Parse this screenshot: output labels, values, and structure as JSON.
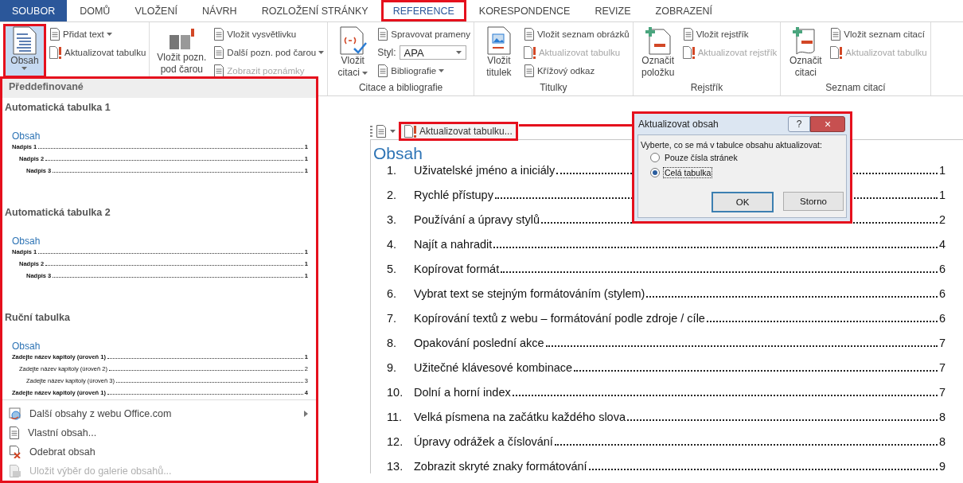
{
  "tabs": [
    {
      "label": "SOUBOR",
      "kind": "file",
      "selected": false
    },
    {
      "label": "DOMŮ",
      "kind": "tab",
      "selected": false
    },
    {
      "label": "VLOŽENÍ",
      "kind": "tab",
      "selected": false
    },
    {
      "label": "NÁVRH",
      "kind": "tab",
      "selected": false
    },
    {
      "label": "ROZLOŽENÍ STRÁNKY",
      "kind": "tab",
      "selected": false
    },
    {
      "label": "REFERENCE",
      "kind": "tab",
      "selected": true
    },
    {
      "label": "KORESPONDENCE",
      "kind": "tab",
      "selected": false
    },
    {
      "label": "REVIZE",
      "kind": "tab",
      "selected": false
    },
    {
      "label": "ZOBRAZENÍ",
      "kind": "tab",
      "selected": false
    }
  ],
  "ribbon": {
    "groups": [
      {
        "large": [
          {
            "lines": [
              "Obsah"
            ],
            "caret": true,
            "pressed": true
          }
        ],
        "small": [
          {
            "kind": "button",
            "label": "Přidat text",
            "caret": true,
            "disabled": false
          },
          {
            "kind": "button",
            "label": "Aktualizovat tabulku",
            "caret": false,
            "disabled": false
          }
        ]
      },
      {
        "large": [
          {
            "lines": [
              "Vložit pozn.",
              "pod čarou"
            ],
            "caret": false,
            "pressed": false
          }
        ],
        "small": [
          {
            "kind": "button",
            "label": "Vložit vysvětlivku",
            "caret": false,
            "disabled": false
          },
          {
            "kind": "button",
            "label": "Další pozn. pod čarou",
            "caret": true,
            "disabled": false
          },
          {
            "kind": "button",
            "label": "Zobrazit poznámky",
            "caret": false,
            "disabled": true
          }
        ]
      },
      {
        "label": "Citace a bibliografie",
        "large": [
          {
            "lines": [
              "Vložit",
              "citaci"
            ],
            "caret": true,
            "pressed": false
          }
        ],
        "small": [
          {
            "kind": "button",
            "label": "Spravovat prameny",
            "caret": false,
            "disabled": false
          },
          {
            "kind": "select",
            "label": "Styl:",
            "value": "APA"
          },
          {
            "kind": "button",
            "label": "Bibliografie",
            "caret": true,
            "disabled": false
          }
        ]
      },
      {
        "label": "Titulky",
        "large": [
          {
            "lines": [
              "Vložit",
              "titulek"
            ],
            "caret": false,
            "pressed": false
          }
        ],
        "small": [
          {
            "kind": "button",
            "label": "Vložit seznam obrázků",
            "caret": false,
            "disabled": false
          },
          {
            "kind": "button",
            "label": "Aktualizovat tabulku",
            "caret": false,
            "disabled": true
          },
          {
            "kind": "button",
            "label": "Křížový odkaz",
            "caret": false,
            "disabled": false
          }
        ]
      },
      {
        "label": "Rejstřík",
        "large": [
          {
            "lines": [
              "Označit",
              "položku"
            ],
            "caret": false,
            "pressed": false
          }
        ],
        "small": [
          {
            "kind": "button",
            "label": "Vložit rejstřík",
            "caret": false,
            "disabled": false
          },
          {
            "kind": "button",
            "label": "Aktualizovat rejstřík",
            "caret": false,
            "disabled": true
          }
        ]
      },
      {
        "label": "Seznam citací",
        "large": [
          {
            "lines": [
              "Označit",
              "citaci"
            ],
            "caret": false,
            "pressed": false
          }
        ],
        "small": [
          {
            "kind": "button",
            "label": "Vložit seznam citací",
            "caret": false,
            "disabled": false
          },
          {
            "kind": "button",
            "label": "Aktualizovat tabulku",
            "caret": false,
            "disabled": true
          }
        ]
      }
    ]
  },
  "gallery": {
    "header": "Předdefinované",
    "sections": [
      {
        "title": "Automatická tabulka 1",
        "heading": "Obsah",
        "entries": [
          {
            "text": "Nadpis 1",
            "page": "1",
            "bold": true,
            "children": [
              {
                "text": "Nadpis 2",
                "page": "1",
                "bold": true,
                "children": [
                  {
                    "text": "Nadpis 3",
                    "page": "1",
                    "bold": true
                  }
                ]
              }
            ]
          }
        ]
      },
      {
        "title": "Automatická tabulka 2",
        "heading": "Obsah",
        "entries": [
          {
            "text": "Nadpis 1",
            "page": "1",
            "bold": true,
            "children": [
              {
                "text": "Nadpis 2",
                "page": "1",
                "bold": true,
                "children": [
                  {
                    "text": "Nadpis 3",
                    "page": "1",
                    "bold": true
                  }
                ]
              }
            ]
          }
        ]
      },
      {
        "title": "Ruční tabulka",
        "heading": "Obsah",
        "entries": [
          {
            "text": "Zadejte název kapitoly (úroveň 1)",
            "page": "1",
            "bold": true,
            "children": [
              {
                "text": "Zadejte název kapitoly (úroveň 2)",
                "page": "2",
                "bold": false,
                "children": [
                  {
                    "text": "Zadejte název kapitoly (úroveň 3)",
                    "page": "3",
                    "bold": false
                  }
                ]
              }
            ]
          },
          {
            "text": "Zadejte název kapitoly (úroveň 1)",
            "page": "4",
            "bold": true
          }
        ]
      }
    ],
    "menu": [
      {
        "label": "Další obsahy z webu Office.com",
        "disabled": false,
        "submenu": true
      },
      {
        "label": "Vlastní obsah...",
        "disabled": false,
        "submenu": false
      },
      {
        "label": "Odebrat obsah",
        "disabled": false,
        "submenu": false
      },
      {
        "label": "Uložit výběr do galerie obsahů...",
        "disabled": true,
        "submenu": false
      }
    ]
  },
  "floating_toolbar": {
    "button": "Aktualizovat tabulku..."
  },
  "document": {
    "heading": "Obsah",
    "toc": [
      {
        "number": "1.",
        "text": "Uživatelské jméno a iniciály",
        "page": "1"
      },
      {
        "number": "2.",
        "text": "Rychlé přístupy",
        "page": "1"
      },
      {
        "number": "3.",
        "text": "Používání a úpravy stylů",
        "page": "2"
      },
      {
        "number": "4.",
        "text": "Najít a nahradit",
        "page": "4"
      },
      {
        "number": "5.",
        "text": "Kopírovat formát",
        "page": "6"
      },
      {
        "number": "6.",
        "text": "Vybrat text se stejným formátováním (stylem)",
        "page": "6"
      },
      {
        "number": "7.",
        "text": "Kopírování textů z webu – formátování podle zdroje / cíle",
        "page": "6"
      },
      {
        "number": "8.",
        "text": "Opakování poslední akce",
        "page": "7"
      },
      {
        "number": "9.",
        "text": "Užitečné klávesové kombinace",
        "page": "7"
      },
      {
        "number": "10.",
        "text": "Dolní a horní index",
        "page": "7"
      },
      {
        "number": "11.",
        "text": "Velká písmena na začátku každého slova",
        "page": "8"
      },
      {
        "number": "12.",
        "text": "Úpravy odrážek a číslování",
        "page": "8"
      },
      {
        "number": "13.",
        "text": "Zobrazit skryté znaky formátování",
        "page": "9"
      }
    ]
  },
  "dialog": {
    "title": "Aktualizovat obsah",
    "help": "?",
    "close": "×",
    "prompt": "Vyberte, co se má v tabulce obsahu aktualizovat:",
    "options": [
      {
        "label": "Pouze čísla stránek",
        "selected": false
      },
      {
        "label": "Celá tabulka",
        "selected": true
      }
    ],
    "buttons": [
      {
        "label": "OK",
        "default": true
      },
      {
        "label": "Storno",
        "default": false
      }
    ]
  }
}
